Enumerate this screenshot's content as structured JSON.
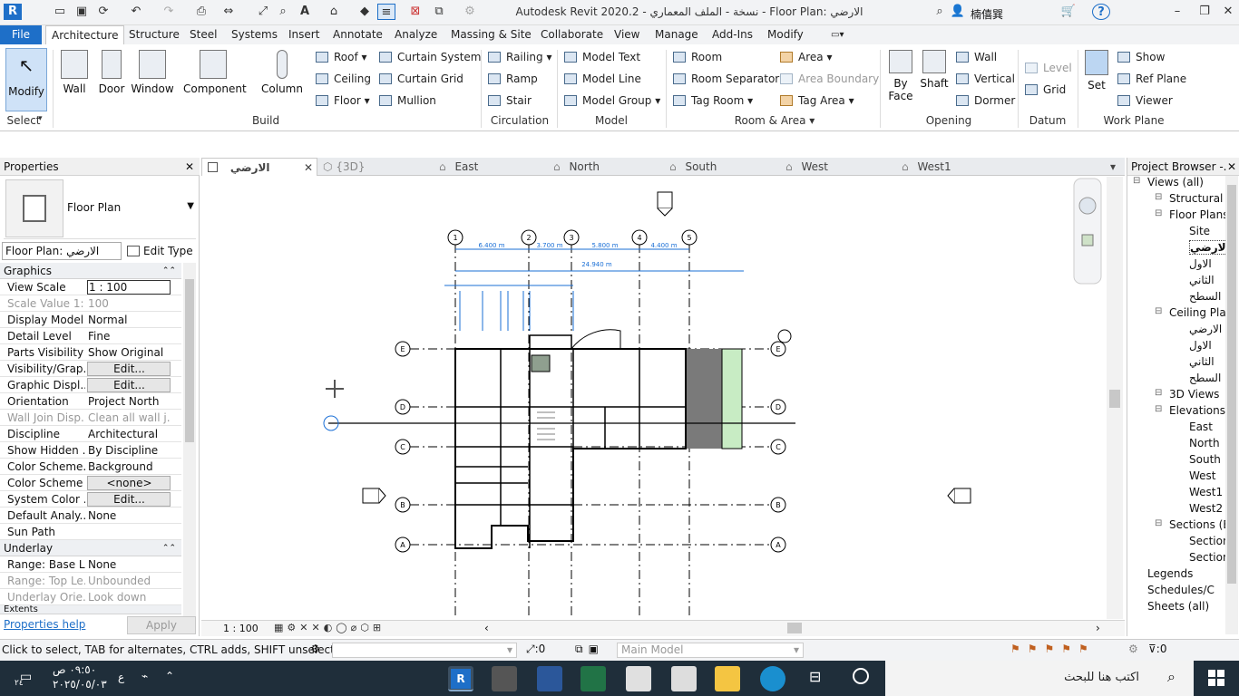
{
  "app": {
    "title": "Autodesk Revit 2020.2 - نسخة - الملف المعماري - Floor Plan: الارضي",
    "user": "楠僖巽",
    "logo": "R"
  },
  "tabs": [
    "File",
    "Architecture",
    "Structure",
    "Steel",
    "Systems",
    "Insert",
    "Annotate",
    "Analyze",
    "Massing & Site",
    "Collaborate",
    "View",
    "Manage",
    "Add-Ins",
    "Modify"
  ],
  "ribbon": {
    "select": {
      "modify": "Modify",
      "select_label": "Select"
    },
    "build": {
      "wall": "Wall",
      "door": "Door",
      "window": "Window",
      "component": "Component",
      "column": "Column",
      "roof": "Roof",
      "ceiling": "Ceiling",
      "floor": "Floor",
      "curtain_system": "Curtain System",
      "curtain_grid": "Curtain Grid",
      "mullion": "Mullion",
      "panel": "Build"
    },
    "circulation": {
      "railing": "Railing",
      "ramp": "Ramp",
      "stair": "Stair",
      "panel": "Circulation"
    },
    "model": {
      "text": "Model Text",
      "line": "Model Line",
      "group": "Model Group",
      "panel": "Model"
    },
    "room_area": {
      "room": "Room",
      "separator": "Room Separator",
      "tag_room": "Tag Room",
      "area": "Area",
      "area_boundary": "Area Boundary",
      "tag_area": "Tag Area",
      "panel": "Room & Area"
    },
    "opening": {
      "by_face": "By Face",
      "shaft": "Shaft",
      "wall": "Wall",
      "vertical": "Vertical",
      "dormer": "Dormer",
      "panel": "Opening"
    },
    "datum": {
      "level": "Level",
      "grid": "Grid",
      "panel": "Datum"
    },
    "work_plane": {
      "set": "Set",
      "show": "Show",
      "ref_plane": "Ref Plane",
      "viewer": "Viewer",
      "panel": "Work Plane"
    }
  },
  "properties": {
    "header": "Properties",
    "family": "Floor Plan",
    "type_selector": "Floor Plan: الارضي",
    "edit_type": "Edit Type",
    "sections": {
      "graphics": "Graphics",
      "underlay": "Underlay",
      "extents": "Extents"
    },
    "graphics_rows": [
      {
        "k": "View Scale",
        "v": "1 : 100"
      },
      {
        "k": "Scale Value    1:",
        "v": "100"
      },
      {
        "k": "Display Model",
        "v": "Normal"
      },
      {
        "k": "Detail Level",
        "v": "Fine"
      },
      {
        "k": "Parts Visibility",
        "v": "Show Original"
      },
      {
        "k": "Visibility/Grap...",
        "v": "Edit..."
      },
      {
        "k": "Graphic Displ...",
        "v": "Edit..."
      },
      {
        "k": "Orientation",
        "v": "Project North"
      },
      {
        "k": "Wall Join Disp...",
        "v": "Clean all wall j..."
      },
      {
        "k": "Discipline",
        "v": "Architectural"
      },
      {
        "k": "Show Hidden ...",
        "v": "By Discipline"
      },
      {
        "k": "Color Scheme...",
        "v": "Background"
      },
      {
        "k": "Color Scheme",
        "v": "<none>"
      },
      {
        "k": "System Color ...",
        "v": "Edit..."
      },
      {
        "k": "Default Analy...",
        "v": "None"
      },
      {
        "k": "Sun Path",
        "v": ""
      }
    ],
    "underlay_rows": [
      {
        "k": "Range: Base L...",
        "v": "None"
      },
      {
        "k": "Range: Top Le...",
        "v": "Unbounded"
      },
      {
        "k": "Underlay Orie...",
        "v": "Look down"
      }
    ],
    "help": "Properties help",
    "apply": "Apply"
  },
  "view_tabs": [
    "الارضي",
    "{3D}",
    "East",
    "North",
    "South",
    "West",
    "West1"
  ],
  "plan": {
    "grid_cols": [
      "1",
      "2",
      "3",
      "4",
      "5"
    ],
    "grid_rows": [
      "E",
      "D",
      "C",
      "B",
      "A"
    ],
    "dims": [
      "6.400 m",
      "3.700 m",
      "5.800 m",
      "4.400 m",
      "24.940 m"
    ]
  },
  "view_bar": {
    "scale": "1 : 100"
  },
  "project_browser": {
    "header": "Project Browser -...",
    "items": [
      {
        "label": "Views (all)",
        "level": 0
      },
      {
        "label": "Structural P",
        "level": 1
      },
      {
        "label": "Floor Plans",
        "level": 1
      },
      {
        "label": "Site",
        "level": 2
      },
      {
        "label": "الارضي",
        "level": 2
      },
      {
        "label": "الاول",
        "level": 2
      },
      {
        "label": "الثاني",
        "level": 2
      },
      {
        "label": "السطح",
        "level": 2
      },
      {
        "label": "Ceiling Plan",
        "level": 1
      },
      {
        "label": "الارضي",
        "level": 2
      },
      {
        "label": "الاول",
        "level": 2
      },
      {
        "label": "الثاني",
        "level": 2
      },
      {
        "label": "السطح",
        "level": 2
      },
      {
        "label": "3D Views",
        "level": 1
      },
      {
        "label": "Elevations (",
        "level": 1
      },
      {
        "label": "East",
        "level": 2
      },
      {
        "label": "North",
        "level": 2
      },
      {
        "label": "South",
        "level": 2
      },
      {
        "label": "West",
        "level": 2
      },
      {
        "label": "West1",
        "level": 2
      },
      {
        "label": "West2",
        "level": 2
      },
      {
        "label": "Sections (Bu",
        "level": 1
      },
      {
        "label": "Section",
        "level": 2
      },
      {
        "label": "Section",
        "level": 2
      },
      {
        "label": "Legends",
        "level": 0
      },
      {
        "label": "Schedules/C",
        "level": 0
      },
      {
        "label": "Sheets (all)",
        "level": 0
      }
    ]
  },
  "status": {
    "hint": "Click to select, TAB for alternates, CTRL adds, SHIFT unselects.",
    "zero": ":0",
    "model": "Main Model",
    "filter": ":0"
  },
  "taskbar": {
    "time": "٠٩:٥٠ ص",
    "date": "٢٠٢٥/٠٥/٠٣",
    "lang": "ع",
    "notif": "٢٤",
    "search": "اكتب هنا للبحث"
  },
  "colors": {
    "accent": "#1e6fc8",
    "dim": "#1a6fd6",
    "taskbar": "#1f2e3a"
  }
}
